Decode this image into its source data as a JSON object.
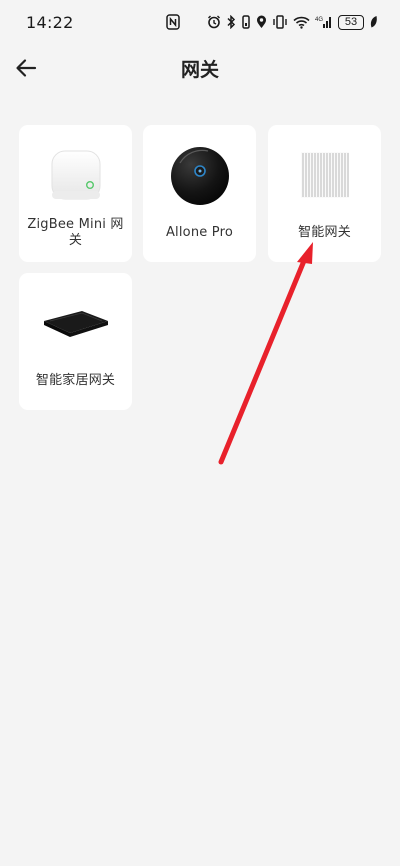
{
  "status_bar": {
    "time": "14:22",
    "battery": "53",
    "icons": [
      "nfc-icon",
      "alarm-icon",
      "bluetooth-icon",
      "vibrate-icon",
      "location-icon",
      "vibrate-mode-icon",
      "wifi-icon",
      "signal-icon",
      "leaf-icon"
    ]
  },
  "header": {
    "title": "网关",
    "back_icon": "arrow-left-icon"
  },
  "devices": [
    {
      "label": "ZigBee Mini 网关",
      "image": "zigbee-mini-hub"
    },
    {
      "label": "Allone Pro",
      "image": "allone-pro-hub"
    },
    {
      "label": "智能网关",
      "image": "smart-gateway"
    },
    {
      "label": "智能家居网关",
      "image": "smart-home-gateway"
    }
  ],
  "colors": {
    "background": "#f4f4f4",
    "card": "#ffffff",
    "annotation_arrow": "#e8212b"
  }
}
